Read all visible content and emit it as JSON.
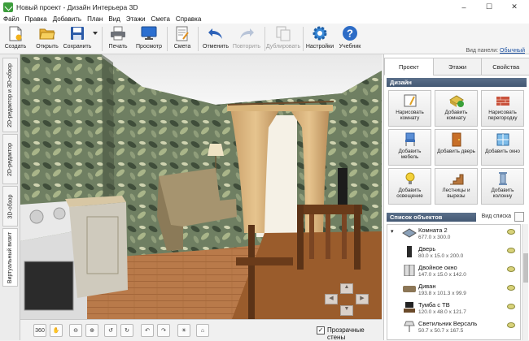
{
  "window": {
    "title": "Новый проект - Дизайн Интерьера 3D",
    "controls": [
      "minimize",
      "maximize",
      "close"
    ]
  },
  "menu": [
    "Файл",
    "Правка",
    "Добавить",
    "План",
    "Вид",
    "Этажи",
    "Смета",
    "Справка"
  ],
  "toolbar": {
    "buttons": [
      {
        "label": "Создать",
        "icon": "new-document-icon",
        "enabled": true
      },
      {
        "label": "Открыть",
        "icon": "folder-open-icon",
        "enabled": true
      },
      {
        "label": "Сохранить",
        "icon": "floppy-disk-icon",
        "enabled": true
      },
      {
        "label": "Печать",
        "icon": "printer-icon",
        "enabled": true
      },
      {
        "label": "Просмотр",
        "icon": "monitor-icon",
        "enabled": true
      },
      {
        "label": "Смета",
        "icon": "estimate-icon",
        "enabled": true
      },
      {
        "label": "Отменить",
        "icon": "undo-icon",
        "enabled": true
      },
      {
        "label": "Повторить",
        "icon": "redo-icon",
        "enabled": false
      },
      {
        "label": "Дублировать",
        "icon": "duplicate-icon",
        "enabled": false
      },
      {
        "label": "Настройки",
        "icon": "gear-icon",
        "enabled": true
      },
      {
        "label": "Учебник",
        "icon": "help-icon",
        "enabled": true
      }
    ],
    "panel_view_label": "Вид панели:",
    "panel_view_value": "Обычный"
  },
  "left_tabs": [
    "2D-редактор и 3D-обзор",
    "2D-редактор",
    "3D-обзор",
    "Виртуальный визит"
  ],
  "left_tabs_active": "Виртуальный визит",
  "bottom_bar": {
    "buttons": [
      "rotate-360-icon",
      "hand-pan-icon",
      "zoom-out-icon",
      "zoom-in-icon",
      "rotate-left-icon",
      "rotate-right-icon",
      "tilt-up-icon",
      "tilt-down-icon",
      "lightbulb-icon",
      "home-icon"
    ],
    "transparent_walls_label": "Прозрачные стены",
    "transparent_walls_checked": true
  },
  "right_panel": {
    "tabs": [
      "Проект",
      "Этажи",
      "Свойства"
    ],
    "active_tab": "Проект",
    "section_title": "Дизайн",
    "actions": [
      {
        "label": "Нарисовать комнату",
        "icon": "draw-room-icon"
      },
      {
        "label": "Добавить комнату",
        "icon": "add-room-icon"
      },
      {
        "label": "Нарисовать перегородку",
        "icon": "partition-icon"
      },
      {
        "label": "Добавить мебель",
        "icon": "chair-icon"
      },
      {
        "label": "Добавить дверь",
        "icon": "door-icon"
      },
      {
        "label": "Добавить окно",
        "icon": "window-icon"
      },
      {
        "label": "Добавить освещение",
        "icon": "lamp-icon"
      },
      {
        "label": "Лестницы и вырезы",
        "icon": "stairs-icon"
      },
      {
        "label": "Добавить колонну",
        "icon": "column-icon"
      }
    ],
    "objects_title": "Список объектов",
    "view_list_label": "Вид списка",
    "objects": [
      {
        "name": "Комната 2",
        "dims": "677.0 x 300.0",
        "icon": "room-icon"
      },
      {
        "name": "Дверь",
        "dims": "80.0 x 15.0 x 200.0",
        "icon": "door-icon"
      },
      {
        "name": "Двойное окно",
        "dims": "147.0 x 15.0 x 142.0",
        "icon": "window-icon"
      },
      {
        "name": "Диван",
        "dims": "193.8 x 101.3 x 99.9",
        "icon": "sofa-icon"
      },
      {
        "name": "Тумба с ТВ",
        "dims": "120.0 x 48.0 x 121.7",
        "icon": "tv-stand-icon"
      },
      {
        "name": "Светильник Версаль",
        "dims": "50.7 x 50.7 x 167.5",
        "icon": "lamp-icon"
      }
    ]
  },
  "colors": {
    "section_header": "#4f6580",
    "accent_blue": "#1a4fa0"
  }
}
